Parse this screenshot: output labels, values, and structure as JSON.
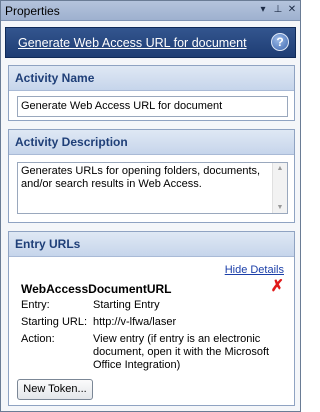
{
  "window": {
    "title": "Properties",
    "controls": [
      "▾",
      "⊥",
      "✕"
    ]
  },
  "header": {
    "title": "Generate Web Access URL for document",
    "help_icon": "?"
  },
  "activity_name": {
    "heading": "Activity Name",
    "value": "Generate Web Access URL for document"
  },
  "activity_description": {
    "heading": "Activity Description",
    "value": "Generates URLs for opening folders, documents, and/or search results in Web Access."
  },
  "entry_urls": {
    "heading": "Entry URLs",
    "hide_details_label": "Hide Details",
    "entry": {
      "name": "WebAccessDocumentURL",
      "rows": [
        {
          "label": "Entry:",
          "value": "Starting Entry"
        },
        {
          "label": "Starting URL:",
          "value": "http://v-lfwa/laser"
        },
        {
          "label": "Action:",
          "value": "View entry (if entry is an electronic document, open it with the Microsoft Office Integration)"
        }
      ]
    },
    "new_token_button": "New Token..."
  },
  "colors": {
    "accent": "#1e3d74",
    "panel_heading": "#1f3f78",
    "link": "#1a3ea8",
    "delete": "#e01a1a"
  }
}
